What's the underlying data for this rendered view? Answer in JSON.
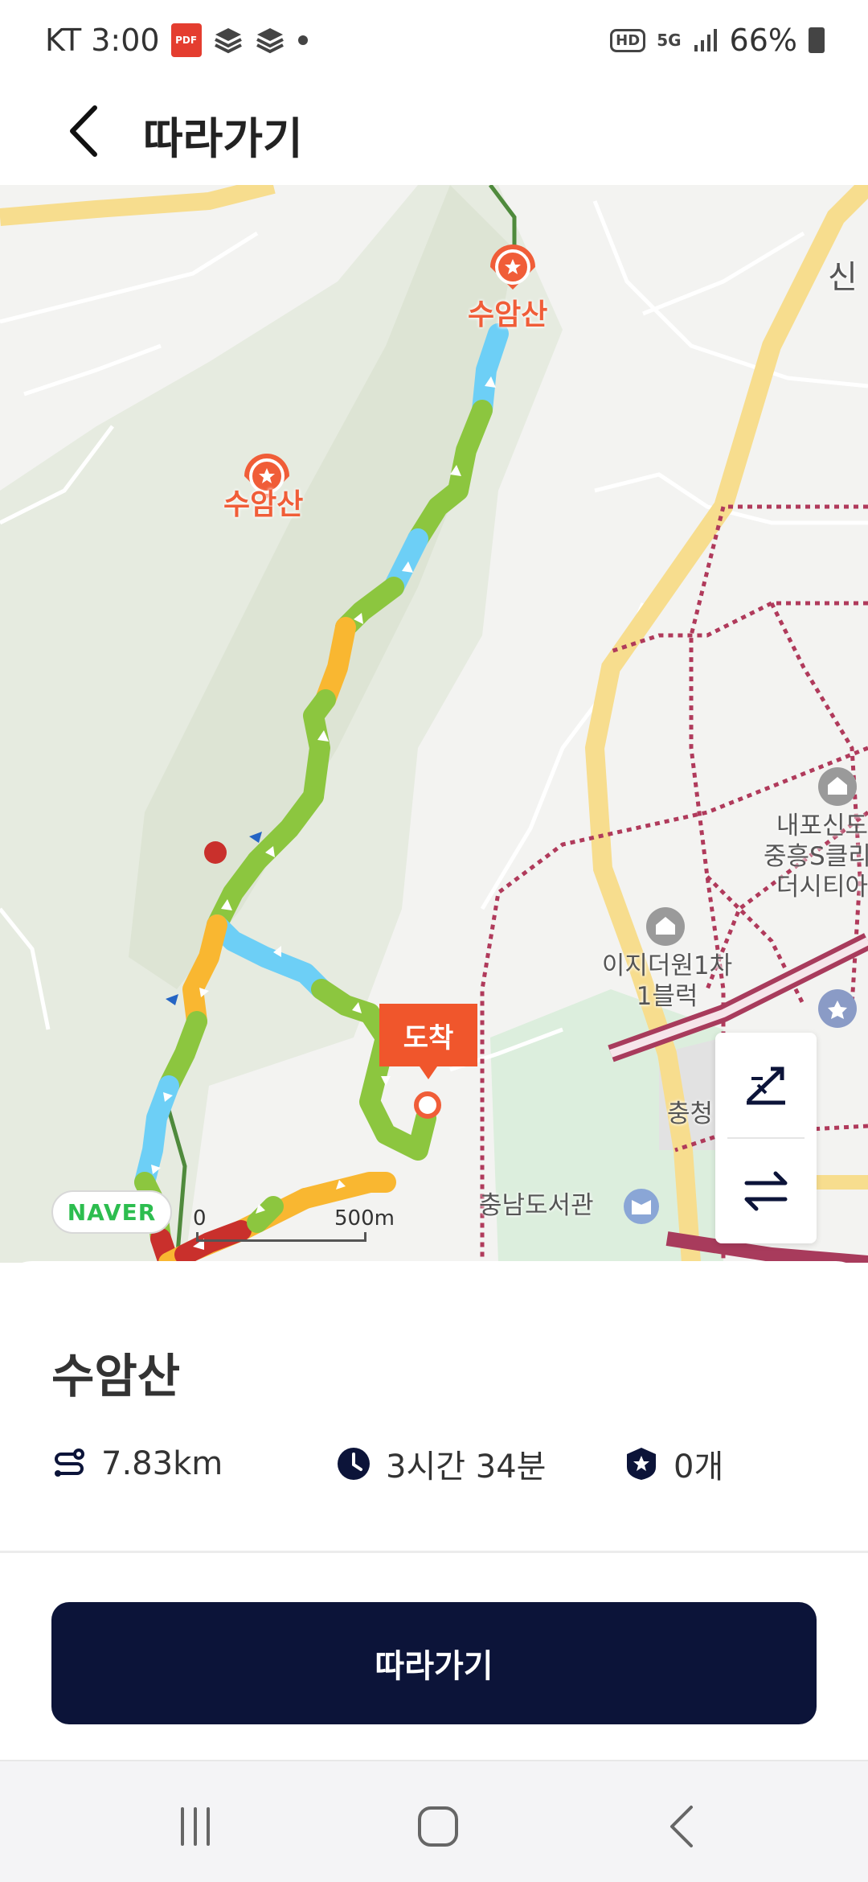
{
  "status_bar": {
    "carrier_time": "KT 3:00",
    "pdf_label": "PDF",
    "hd_label": "HD",
    "network_label": "5G",
    "battery": "66%"
  },
  "header": {
    "title": "따라가기"
  },
  "map": {
    "poi_labels": [
      "수암산",
      "수암산"
    ],
    "places": {
      "complex": "내포신도\n중흥S클리\n더시티아",
      "apartment": "이지더원1차\n1블럭",
      "library": "충남도서관",
      "partial_top_right": "신",
      "partial_chung": "충청"
    },
    "arrival_label": "도착",
    "naver_badge": "NAVER",
    "scale_zero": "0",
    "scale_distance": "500m"
  },
  "trail": {
    "name": "수암산",
    "distance": "7.83km",
    "duration": "3시간 34분",
    "stamps": "0개"
  },
  "actions": {
    "follow_label": "따라가기"
  },
  "colors": {
    "primary_button": "#0c1439",
    "accent_orange": "#f0562c",
    "route_green": "#8cc63f",
    "route_blue": "#6dcff6",
    "route_yellow": "#f9b731",
    "route_red": "#c9302c"
  }
}
